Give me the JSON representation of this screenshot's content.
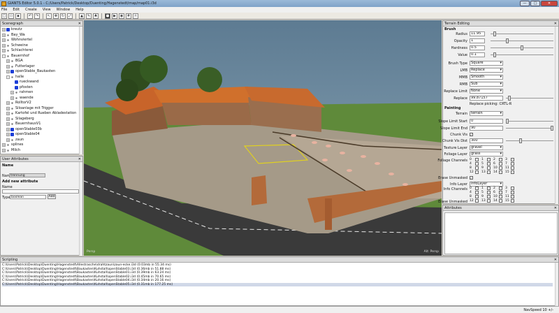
{
  "window": {
    "title": "GIANTS Editor 5.0.1 - C:/Users/Patrick/Desktop/Duenting/Hagenstedt/map/map01.i3d",
    "min": "—",
    "max": "□",
    "close": "✕"
  },
  "menu": [
    "File",
    "Edit",
    "Create",
    "View",
    "Window",
    "Help"
  ],
  "scenegraph": {
    "title": "Scenegraph",
    "close": "✕",
    "nodes": [
      {
        "label": "kreutz",
        "indent": 1,
        "icon": "shape",
        "exp": "+"
      },
      {
        "label": "Bay_Wa",
        "indent": 1,
        "icon": "group",
        "exp": "+"
      },
      {
        "label": "Wohnviertel",
        "indent": 1,
        "icon": "group",
        "exp": "+"
      },
      {
        "label": "Schweine",
        "indent": 1,
        "icon": "group",
        "exp": "+"
      },
      {
        "label": "Schlachterei",
        "indent": 1,
        "icon": "group",
        "exp": "+"
      },
      {
        "label": "Bauernhof",
        "indent": 1,
        "icon": "group",
        "exp": "-"
      },
      {
        "label": "BGA",
        "indent": 2,
        "icon": "group",
        "exp": "+"
      },
      {
        "label": "Futterlager",
        "indent": 2,
        "icon": "group",
        "exp": "+"
      },
      {
        "label": "openStable_Baukasten",
        "indent": 2,
        "icon": "shape",
        "exp": "+"
      },
      {
        "label": "halle",
        "indent": 2,
        "icon": "group",
        "exp": "-"
      },
      {
        "label": "rueckwand",
        "indent": 3,
        "icon": "shape",
        "exp": ""
      },
      {
        "label": "pfosten",
        "indent": 3,
        "icon": "shape",
        "exp": ""
      },
      {
        "label": "rahmen",
        "indent": 3,
        "icon": "group",
        "exp": "+"
      },
      {
        "label": "waende",
        "indent": 3,
        "icon": "group",
        "exp": "+"
      },
      {
        "label": "RolltorV2",
        "indent": 2,
        "icon": "group",
        "exp": "+"
      },
      {
        "label": "Siloanlage mit Trigger",
        "indent": 2,
        "icon": "group",
        "exp": "+"
      },
      {
        "label": "Kartofel und Rueben Abladestation",
        "indent": 2,
        "icon": "group",
        "exp": "+"
      },
      {
        "label": "Silageberg",
        "indent": 2,
        "icon": "group",
        "exp": "+"
      },
      {
        "label": "BauernhausV1",
        "indent": 2,
        "icon": "group",
        "exp": "+"
      },
      {
        "label": "openStable03b",
        "indent": 2,
        "icon": "shape",
        "exp": "+"
      },
      {
        "label": "openStable04",
        "indent": 2,
        "icon": "shape",
        "exp": "+"
      },
      {
        "label": "zaun",
        "indent": 2,
        "icon": "group",
        "exp": "+"
      },
      {
        "label": "splines",
        "indent": 1,
        "icon": "group",
        "exp": "+"
      },
      {
        "label": "Milch",
        "indent": 1,
        "icon": "group",
        "exp": "+"
      }
    ]
  },
  "user_attributes": {
    "title": "User Attributes",
    "close": "✕",
    "name_header": "Name",
    "name_label": "Name",
    "name_value": "trennung",
    "add_new": "Add new attribute",
    "new_name_label": "Name",
    "type_label": "Type",
    "type_value": "boolean",
    "add_button": "Add"
  },
  "viewport": {
    "label_left": "Persp",
    "label_right": "Alt: Persp"
  },
  "terrain_editing": {
    "title": "Terrain Editing",
    "close": "✕",
    "brush_section": "Brush",
    "radius_label": "Radius",
    "radius_value": "11.95",
    "radius_level": 0.05,
    "opacity_label": "Opacity",
    "opacity_value": "1",
    "opacity_level": 0.25,
    "hardness_label": "Hardness",
    "hardness_value": "0.5",
    "hardness_level": 0.5,
    "value_label": "Value",
    "value_value": "0.1",
    "value_level": 0.05,
    "brush_type_label": "Brush Type",
    "brush_type_value": "Square",
    "lmb_label": "LMB",
    "lmb_value": "Replace",
    "mmb_label": "MMB",
    "mmb_value": "Smooth",
    "rmb_label": "RMB",
    "rmb_value": "Sub",
    "replace_limit_label": "Replace Limit",
    "replace_limit_value": "None",
    "replace_label": "Replace",
    "replace_value": "99.87157",
    "replace_level": 0.05,
    "replace_picking": "Replace picking: CRTL-R",
    "painting_section": "Painting",
    "terrain_label": "Terrain",
    "terrain_value": "terrain",
    "slope_start_label": "Slope Limit Start",
    "slope_start_value": "0",
    "slope_start_level": 0.0,
    "slope_end_label": "Slope Limit End",
    "slope_end_value": "90",
    "slope_end_level": 1.0,
    "chunk_vis_label": "Chunk Vis",
    "chunk_vis_checked": "✓",
    "chunk_vis_dist_label": "Chunk Vis Dist",
    "chunk_vis_dist_value": "300",
    "chunk_vis_dist_level": 0.3,
    "texture_layer_label": "Texture Layer",
    "texture_layer_value": "gravel",
    "foliage_layer_label": "Foliage Layer",
    "foliage_layer_value": "grass",
    "foliage_channels_label": "Foliage Channels",
    "foliage_channels": [
      "0",
      "1",
      "2",
      "3",
      "4",
      "5",
      "6",
      "7",
      "8",
      "9",
      "10",
      "11",
      "12",
      "13",
      "14",
      "15"
    ],
    "erase_unmasked_label": "Erase Unmasked",
    "erase_unmasked_checked": "✓",
    "info_layer_label": "Info Layer",
    "info_layer_value": "infoLayer",
    "info_channels_label": "Info Channels",
    "info_channels": [
      "0",
      "1",
      "2",
      "3",
      "4",
      "5",
      "6",
      "7",
      "8",
      "9",
      "10",
      "11",
      "12",
      "13",
      "14",
      "15"
    ],
    "erase_unmasked2_label": "Erase Unmasked"
  },
  "attributes": {
    "title": "Attributes",
    "close": "✕"
  },
  "scripting": {
    "title": "Scripting",
    "close": "✕",
    "lines": [
      "C:\\Users\\Patrick\\Desktop\\Duenting\\Hagenstedt\\Allestrasche\\drahtzaun\\zaun-ecke.i3d (0.03mb in 55.34 ms)",
      "C:\\Users\\Patrick\\Desktop\\Duenting\\Hagenstedt\\Baukasten\\Kuhstall\\openStable03.i3d (0.36mb in 51.88 ms)",
      "C:\\Users\\Patrick\\Desktop\\Duenting\\Hagenstedt\\Baukasten\\Kuhstall\\openStable01.i3d (0.39mb in 63.24 ms)",
      "C:\\Users\\Patrick\\Desktop\\Duenting\\Hagenstedt\\Baukasten\\Kuhstall\\openStable02.i3d (0.45mb in 70.65 ms)",
      "C:\\Users\\Patrick\\Desktop\\Duenting\\Hagenstedt\\Baukasten\\Kuhstall\\openStable04.i3d (0.34mb in 20.16 ms)",
      "C:\\Users\\Patrick\\Desktop\\Duenting\\Hagenstedt\\Baukasten\\Kuhstall\\openStable05.i3d (0.31mb in 177.25 ms)"
    ]
  },
  "status": {
    "navspeed": "NavSpeed 10 +/-"
  }
}
